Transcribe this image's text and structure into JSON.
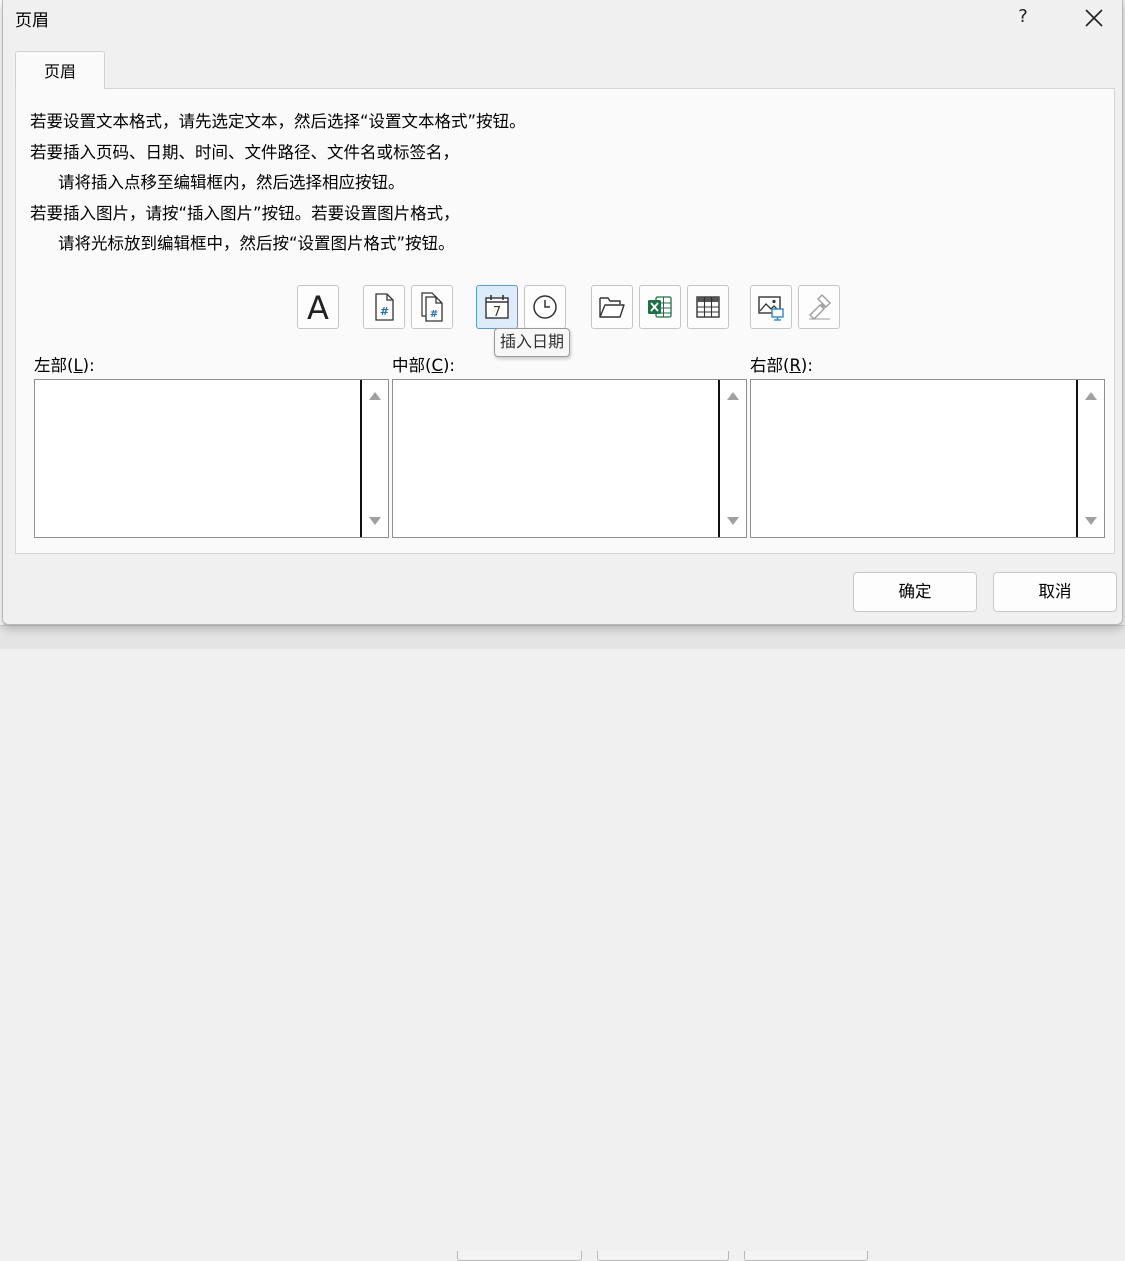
{
  "dialog": {
    "title": "页眉",
    "help": "?",
    "close": "✕"
  },
  "tab": {
    "label": "页眉"
  },
  "instructions": [
    "若要设置文本格式，请先选定文本，然后选择“设置文本格式”按钮。",
    "若要插入页码、日期、时间、文件路径、文件名或标签名，",
    "请将插入点移至编辑框内，然后选择相应按钮。",
    "若要插入图片，请按“插入图片”按钮。若要设置图片格式，",
    "请将光标放到编辑框中，然后按“设置图片格式”按钮。"
  ],
  "toolbar": {
    "format_text_glyph": "A",
    "tooltip": "插入日期",
    "date_glyph": "7",
    "page_glyph": "#"
  },
  "sections": {
    "left": {
      "label_pre": "左部(",
      "key": "L",
      "label_post": "):"
    },
    "center": {
      "label_pre": "中部(",
      "key": "C",
      "label_post": "):"
    },
    "right": {
      "label_pre": "右部(",
      "key": "R",
      "label_post": "):"
    }
  },
  "buttons": {
    "ok": "确定",
    "cancel": "取消"
  },
  "colors": {
    "accent": "#5a9bd8",
    "excel_green": "#1e7145"
  }
}
